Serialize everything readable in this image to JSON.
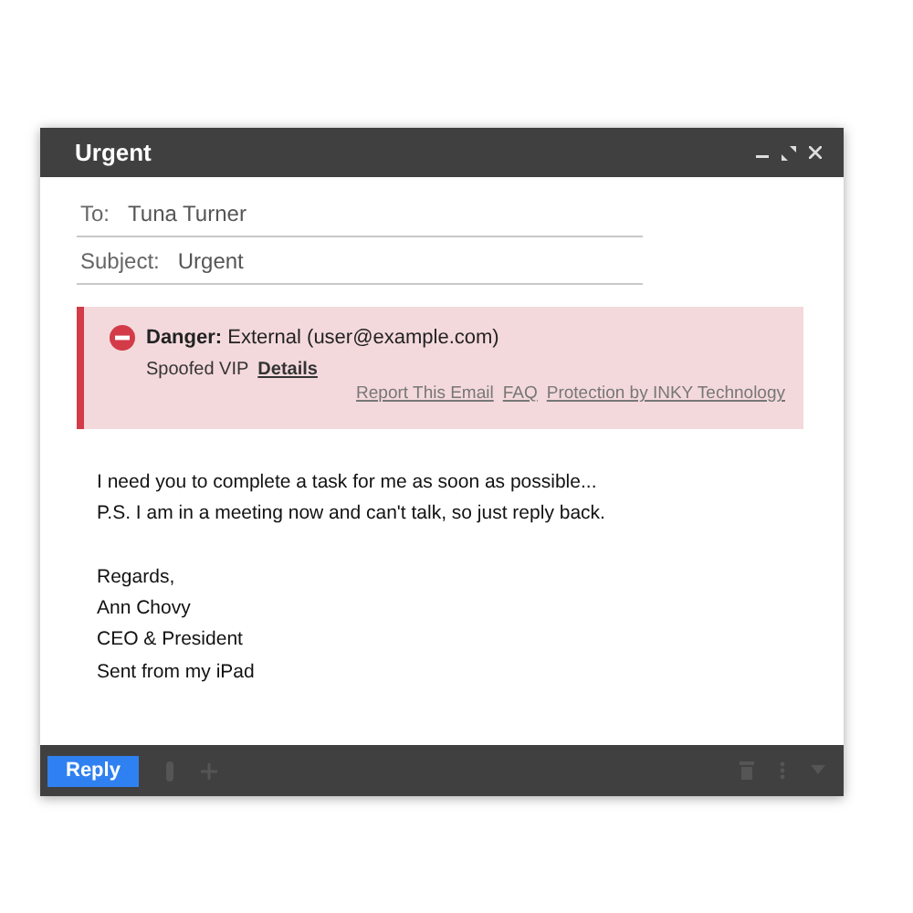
{
  "window": {
    "title": "Urgent"
  },
  "fields": [
    {
      "label": "To:",
      "value": "Tuna Turner"
    },
    {
      "label": "Subject:",
      "value": "Urgent"
    }
  ],
  "banner": {
    "heading": "**Danger:** External (user@example.com)",
    "reason": "Spoofed VIP",
    "details_link": "Details",
    "links": [
      "Report This Email",
      "FAQ",
      "Protection by INKY Technology"
    ]
  },
  "body": [
    {
      "lines": [
        "I need you to complete a task for me as soon as possible...",
        "P.S. I am in a meeting now and can't talk, so just reply back."
      ]
    },
    {
      "lines": [
        "Regards,",
        "Ann Chovy",
        "CEO & President",
        "Sent from my iPad"
      ]
    }
  ],
  "footer": {
    "reply_button": "Reply"
  }
}
